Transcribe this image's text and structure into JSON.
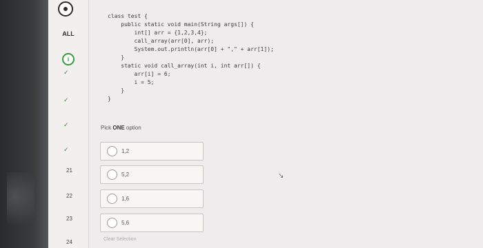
{
  "sidebar": {
    "all_label": "ALL",
    "info_icon": "i",
    "check_mark": "✓",
    "question_numbers": [
      "21",
      "22",
      "23",
      "24"
    ]
  },
  "question": {
    "code_lines": [
      "class test {",
      "    public static void main(String args[]) {",
      "        int[] arr = {1,2,3,4};",
      "        call_array(arr[0], arr);",
      "        System.out.println(arr[0] + \",\" + arr[1]);",
      "    }",
      "    static void call_array(int i, int arr[]) {",
      "        arr[i] = 6;",
      "        i = 5;",
      "    }",
      "}"
    ],
    "pick_prefix": "Pick ",
    "pick_bold": "ONE",
    "pick_suffix": " option",
    "options": [
      "1,2",
      "5,2",
      "1,6",
      "5,6"
    ],
    "clear_selection": "Clear Selection"
  }
}
